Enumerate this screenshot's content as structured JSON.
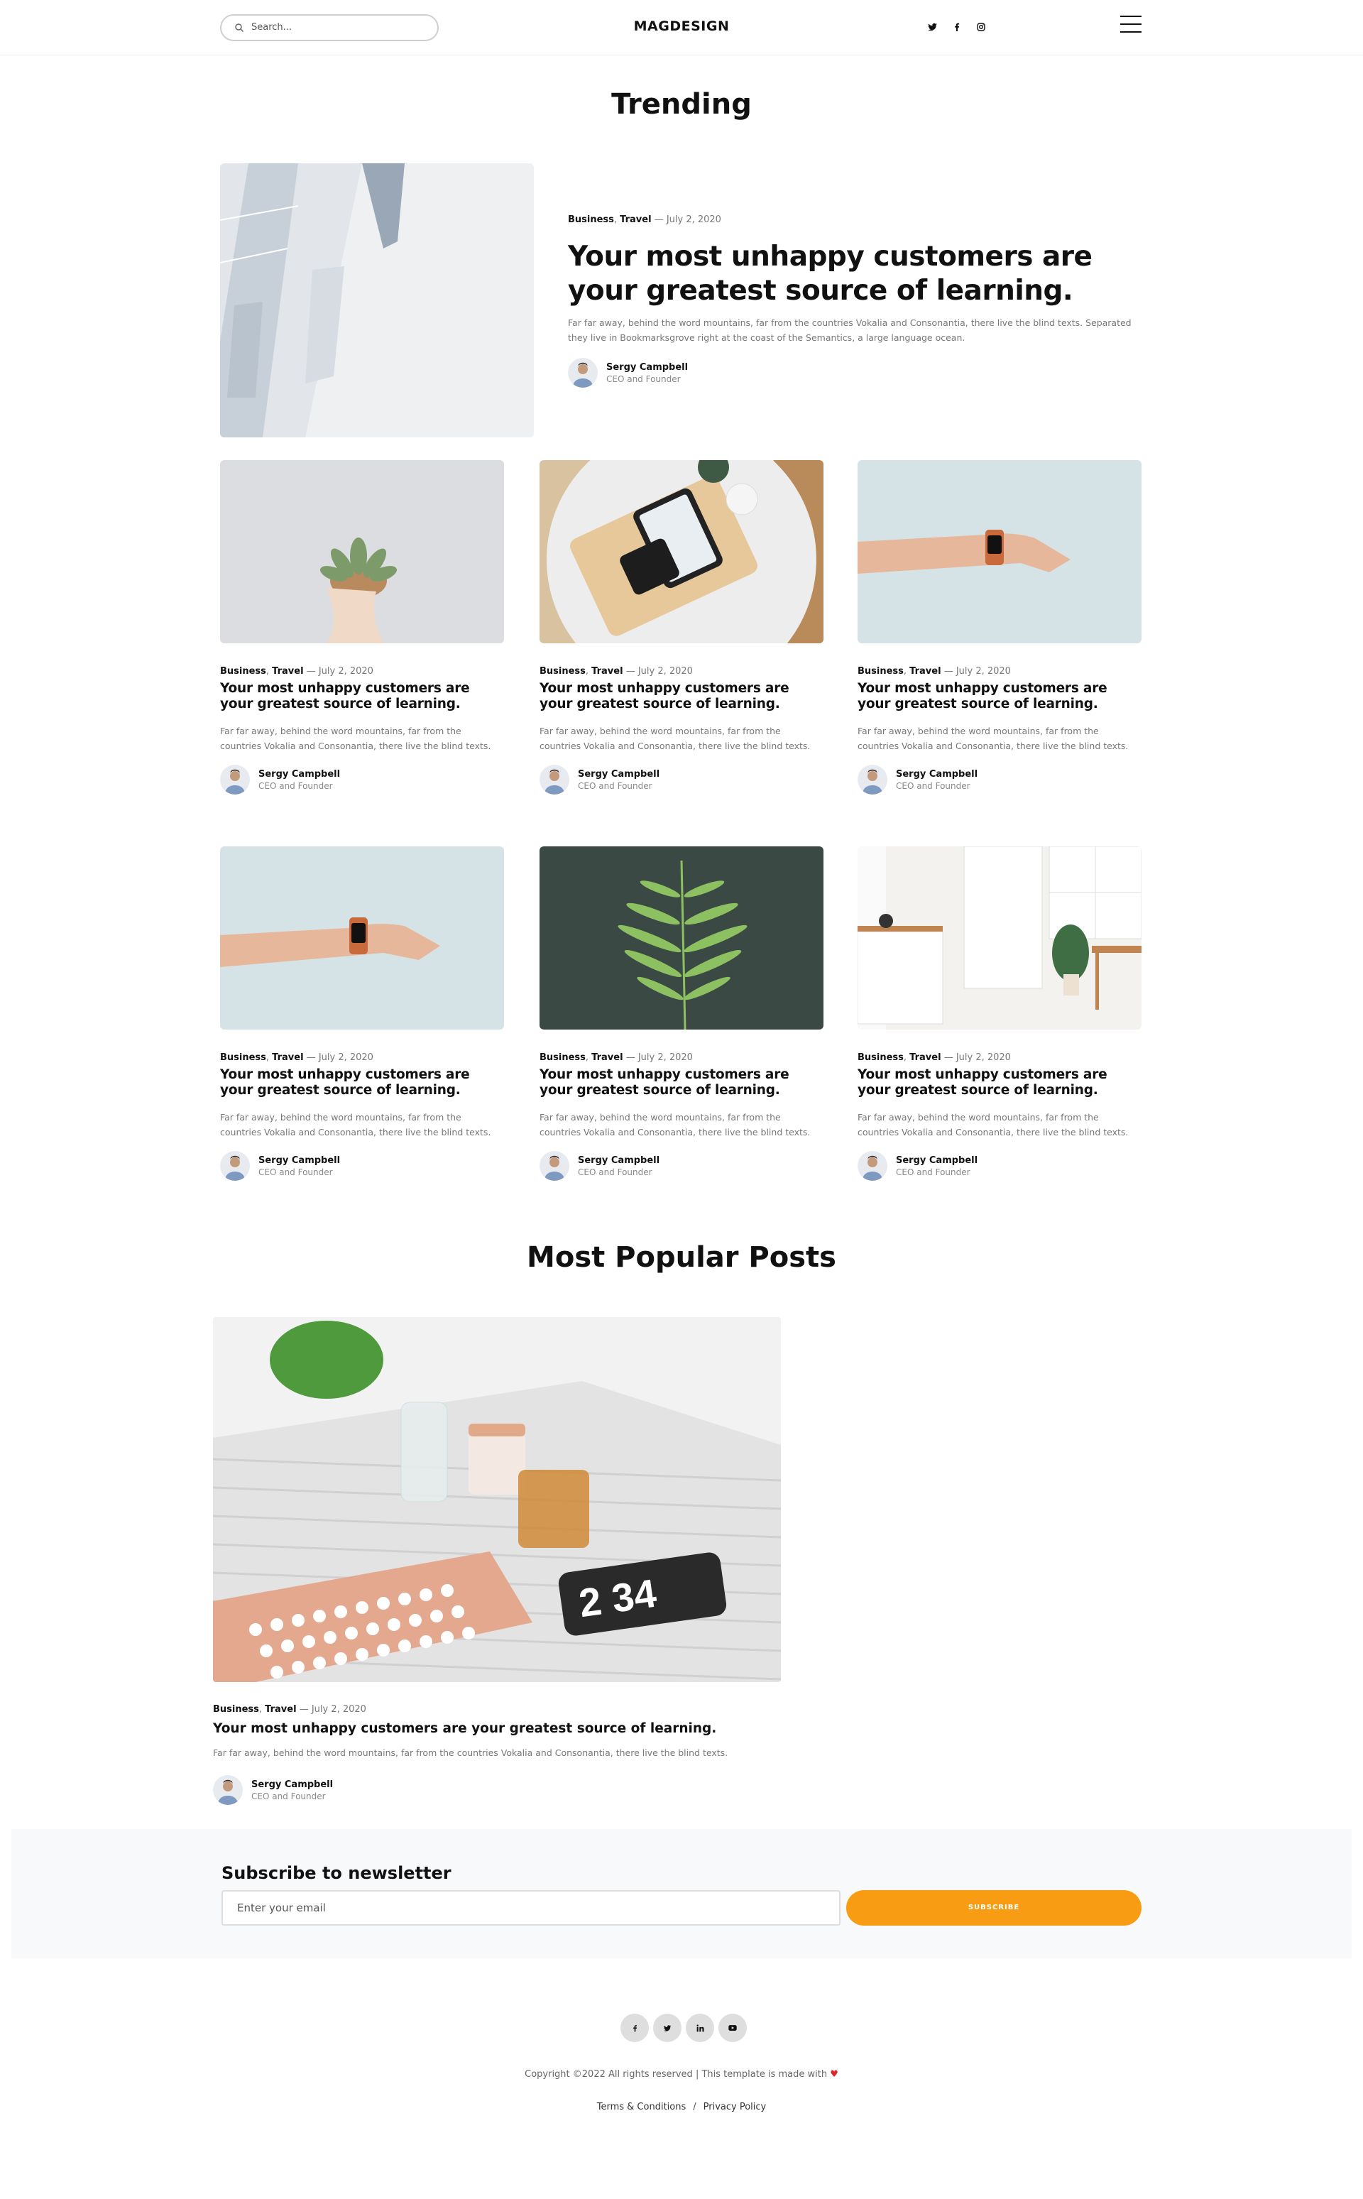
{
  "header": {
    "search_placeholder": "Search...",
    "logo": "MAGDESIGN",
    "social": [
      "twitter-icon",
      "facebook-icon",
      "instagram-icon"
    ],
    "menu_icon": "hamburger-icon"
  },
  "trending": {
    "title": "Trending",
    "featured": {
      "cat1": "Business",
      "cat2": "Travel",
      "date": "— July 2, 2020",
      "title": "Your most unhappy customers are your greatest source of learning.",
      "excerpt": "Far far away, behind the word mountains, far from the countries Vokalia and Consonantia, there live the blind texts. Separated they live in Bookmarksgrove right at the coast of the Semantics, a large language ocean.",
      "author_name": "Sergy Campbell",
      "author_role": "CEO and Founder"
    },
    "cards": [
      {
        "cat1": "Business",
        "cat2": "Travel",
        "date": "— July 2, 2020",
        "title": "Your most unhappy customers are your greatest source of learning.",
        "excerpt": "Far far away, behind the word mountains, far from the countries Vokalia and Consonantia, there live the blind texts.",
        "author_name": "Sergy Campbell",
        "author_role": "CEO and Founder"
      },
      {
        "cat1": "Business",
        "cat2": "Travel",
        "date": "— July 2, 2020",
        "title": "Your most unhappy customers are your greatest source of learning.",
        "excerpt": "Far far away, behind the word mountains, far from the countries Vokalia and Consonantia, there live the blind texts.",
        "author_name": "Sergy Campbell",
        "author_role": "CEO and Founder"
      },
      {
        "cat1": "Business",
        "cat2": "Travel",
        "date": "— July 2, 2020",
        "title": "Your most unhappy customers are your greatest source of learning.",
        "excerpt": "Far far away, behind the word mountains, far from the countries Vokalia and Consonantia, there live the blind texts.",
        "author_name": "Sergy Campbell",
        "author_role": "CEO and Founder"
      },
      {
        "cat1": "Business",
        "cat2": "Travel",
        "date": "— July 2, 2020",
        "title": "Your most unhappy customers are your greatest source of learning.",
        "excerpt": "Far far away, behind the word mountains, far from the countries Vokalia and Consonantia, there live the blind texts.",
        "author_name": "Sergy Campbell",
        "author_role": "CEO and Founder"
      },
      {
        "cat1": "Business",
        "cat2": "Travel",
        "date": "— July 2, 2020",
        "title": "Your most unhappy customers are your greatest source of learning.",
        "excerpt": "Far far away, behind the word mountains, far from the countries Vokalia and Consonantia, there live the blind texts.",
        "author_name": "Sergy Campbell",
        "author_role": "CEO and Founder"
      },
      {
        "cat1": "Business",
        "cat2": "Travel",
        "date": "— July 2, 2020",
        "title": "Your most unhappy customers are your greatest source of learning.",
        "excerpt": "Far far away, behind the word mountains, far from the countries Vokalia and Consonantia, there live the blind texts.",
        "author_name": "Sergy Campbell",
        "author_role": "CEO and Founder"
      }
    ]
  },
  "popular": {
    "title": "Most Popular Posts",
    "cat1": "Business",
    "cat2": "Travel",
    "date": "— July 2, 2020",
    "post_title": "Your most unhappy customers are your greatest source of learning.",
    "excerpt": "Far far away, behind the word mountains, far from the countries Vokalia and Consonantia, there live the blind texts.",
    "author_name": "Sergy Campbell",
    "author_role": "CEO and Founder",
    "clock_text": "2 34"
  },
  "newsletter": {
    "title": "Subscribe to newsletter",
    "input_placeholder": "Enter your email",
    "button_label": "SUBSCRIBE"
  },
  "footer": {
    "social": [
      "facebook-icon",
      "twitter-icon",
      "linkedin-icon",
      "youtube-icon"
    ],
    "copyright": "Copyright ©2022 All rights reserved | This template is made with",
    "heart": "♥",
    "terms": "Terms & Conditions",
    "separator": "/",
    "privacy": "Privacy Policy"
  },
  "colors": {
    "accent": "#f89d13",
    "heart": "#e0242c",
    "text_muted": "#777777",
    "newsletter_bg": "#f8f9fa"
  }
}
